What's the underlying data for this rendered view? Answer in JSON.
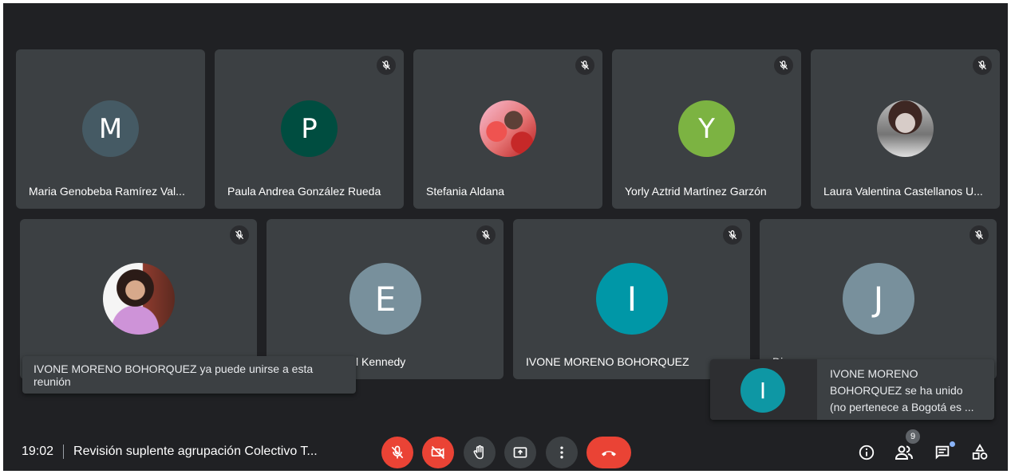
{
  "row1": [
    {
      "name": "Maria Genobeba Ramírez Val...",
      "initial": "M",
      "color": "#455a64",
      "muted": false
    },
    {
      "name": "Paula Andrea González Rueda",
      "initial": "P",
      "color": "#004d40",
      "muted": true
    },
    {
      "name": "Stefania Aldana",
      "initial": "",
      "color": "#e57373",
      "muted": true
    },
    {
      "name": "Yorly Aztrid Martínez Garzón",
      "initial": "Y",
      "color": "#7cb342",
      "muted": true
    },
    {
      "name": "Laura Valentina Castellanos U...",
      "initial": "",
      "color": "#9e9e8e",
      "muted": true
    }
  ],
  "row2": [
    {
      "name": "",
      "initial": "",
      "color": "#8d5a4a",
      "muted": true
    },
    {
      "name": "l Kennedy",
      "initial": "E",
      "color": "#78909c",
      "muted": true
    },
    {
      "name": "IVONE MORENO BOHORQUEZ",
      "initial": "I",
      "color": "#0097a7",
      "muted": true
    },
    {
      "name": "Di",
      "initial": "J",
      "color": "#78909c",
      "muted": true
    }
  ],
  "notifications": {
    "can_join": "IVONE MORENO BOHORQUEZ ya puede unirse a esta reunión",
    "joined_initial": "I",
    "joined_line1": "IVONE MORENO",
    "joined_line2": "BOHORQUEZ se ha unido",
    "joined_line3": "(no pertenece a Bogotá es ..."
  },
  "bottom_bar": {
    "time": "19:02",
    "meeting_title": "Revisión suplente agrupación Colectivo T...",
    "participants_count": "9"
  },
  "controls": [
    "mic-off-icon",
    "camera-off-icon",
    "raise-hand-icon",
    "present-screen-icon",
    "more-options-icon",
    "end-call-icon"
  ],
  "right_icons": [
    "info-icon",
    "people-icon",
    "chat-icon",
    "activities-icon"
  ],
  "colors": {
    "background": "#202124",
    "tile": "#3c4043",
    "danger": "#ea4335",
    "accent": "#8ab4f8"
  }
}
